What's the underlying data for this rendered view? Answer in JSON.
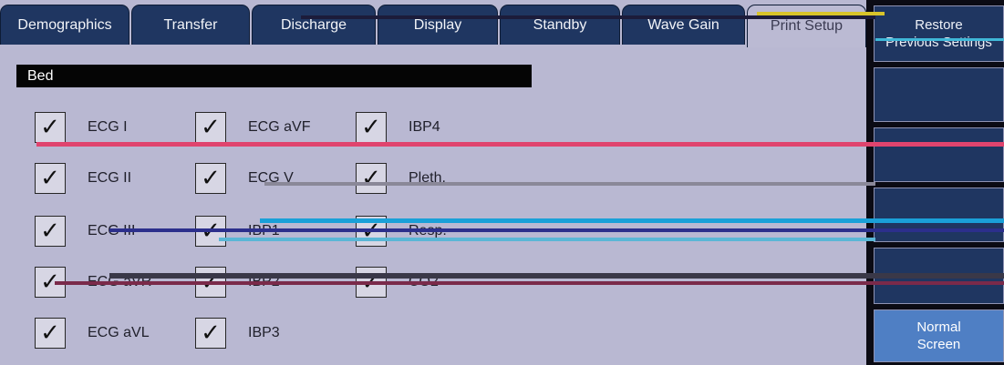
{
  "tabs": [
    {
      "label": "Demographics",
      "active": false
    },
    {
      "label": "Transfer",
      "active": false
    },
    {
      "label": "Discharge",
      "active": false
    },
    {
      "label": "Display",
      "active": false
    },
    {
      "label": "Standby",
      "active": false
    },
    {
      "label": "Wave Gain",
      "active": false
    },
    {
      "label": "Print Setup",
      "active": true
    }
  ],
  "sidebar": {
    "restore_line1": "Restore",
    "restore_line2": "Previous Settings",
    "normal_line1": "Normal",
    "normal_line2": "Screen"
  },
  "bed_label": "Bed",
  "checkmark": "✓",
  "options": {
    "col1": [
      {
        "label": "ECG I",
        "checked": true
      },
      {
        "label": "ECG II",
        "checked": true
      },
      {
        "label": "ECG III",
        "checked": true
      },
      {
        "label": "ECG aVR",
        "checked": true
      },
      {
        "label": "ECG aVL",
        "checked": true
      }
    ],
    "col2": [
      {
        "label": "ECG aVF",
        "checked": true
      },
      {
        "label": "ECG V",
        "checked": true
      },
      {
        "label": "IBP1",
        "checked": true
      },
      {
        "label": "IBP2",
        "checked": true
      },
      {
        "label": "IBP3",
        "checked": true
      }
    ],
    "col3": [
      {
        "label": "IBP4",
        "checked": true
      },
      {
        "label": "Pleth.",
        "checked": true
      },
      {
        "label": "Resp.",
        "checked": true
      },
      {
        "label": "CO2",
        "checked": true
      }
    ]
  },
  "colors": {
    "tab_bg": "#1f3661",
    "panel_bg": "#b9b8d2",
    "accent_button": "#4f7fc4",
    "glitch_pink": "#e0446e",
    "glitch_cyan": "#1aa0d8",
    "glitch_gray": "#8a8898",
    "glitch_navy": "#2c2f8c"
  }
}
